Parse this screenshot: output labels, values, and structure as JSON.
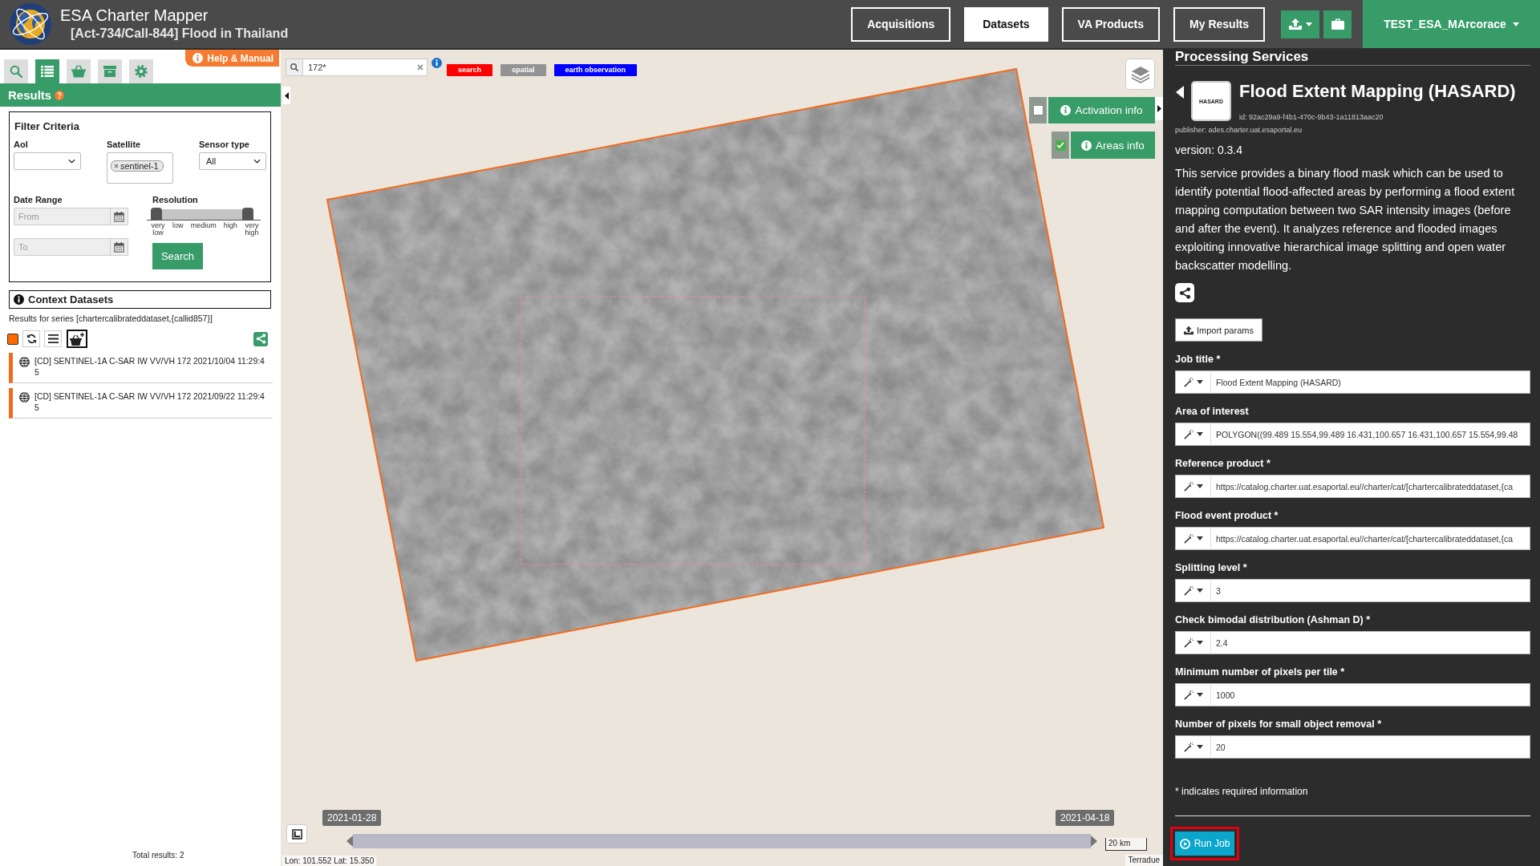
{
  "header": {
    "app_title": "ESA Charter Mapper",
    "subtitle": "[Act-734/Call-844] Flood in Thailand",
    "nav": [
      {
        "label": "Acquisitions",
        "selected": false
      },
      {
        "label": "Datasets",
        "selected": true
      },
      {
        "label": "VA Products",
        "selected": false
      },
      {
        "label": "My Results",
        "selected": false
      }
    ],
    "user": "TEST_ESA_MArcorace"
  },
  "left_panel": {
    "tabs": [
      {
        "kind": "search",
        "selected": false
      },
      {
        "kind": "list",
        "selected": true
      },
      {
        "kind": "basket",
        "selected": false
      },
      {
        "kind": "archive",
        "selected": false
      },
      {
        "kind": "settings",
        "selected": false
      }
    ],
    "help_link": "Help & Manual",
    "results_title": "Results",
    "filter": {
      "title": "Filter Criteria",
      "aoi_label": "AoI",
      "satellite_label": "Satellite",
      "satellite_tags": [
        "sentinel-1"
      ],
      "sensor_label": "Sensor type",
      "sensor_value": "All",
      "date_label": "Date Range",
      "from_placeholder": "From",
      "to_placeholder": "To",
      "resolution_label": "Resolution",
      "resolution_slider": {
        "handles": [
          {
            "level": 0
          },
          {
            "level": 1
          }
        ]
      },
      "resolution_ticks": [
        "very low",
        "low",
        "medium",
        "high",
        "very high"
      ],
      "search_button": "Search"
    },
    "context": {
      "title": "Context Datasets",
      "series": "Results for series [chartercalibrateddataset,{callid857}]",
      "items": [
        {
          "title": "[CD] SENTINEL-1A C-SAR IW VV/VH 172 2021/10/04 11:29:45"
        },
        {
          "title": "[CD] SENTINEL-1A C-SAR IW VV/VH 172 2021/09/22 11:29:45"
        }
      ]
    },
    "total_results": "Total results: 2"
  },
  "map": {
    "search": {
      "value": "172*"
    },
    "filter_tags": [
      {
        "label": "search",
        "color": "#ff0000"
      },
      {
        "label": "spatial",
        "color": "#939393"
      },
      {
        "label": "earth observation",
        "color": "#0000ff"
      }
    ],
    "overlay_buttons": [
      {
        "label": "Activation info",
        "checked": false
      },
      {
        "label": "Areas info",
        "checked": true
      }
    ],
    "timeline": {
      "start": "2021-01-28",
      "end": "2021-04-18",
      "handles": [
        {
          "level": 0
        },
        {
          "level": 1
        }
      ]
    },
    "coordinates": "Lon: 101.552 Lat: 15.350",
    "scale": "20 km",
    "attribution": "Terradue"
  },
  "service": {
    "section_title": "Processing Services",
    "logo_text": "HASARD",
    "title": "Flood Extent Mapping (HASARD)",
    "id": "id: 92ac29a9-f4b1-470c-9b43-1a11813aac20",
    "publisher": "publisher: ades.charter.uat.esaportal.eu",
    "version": "version: 0.3.4",
    "description": "This service provides a binary flood mask which can be used to identify potential flood-affected areas by performing a flood extent mapping computation between two SAR intensity images (before and after the event). It analyzes reference and flooded images exploiting innovative hierarchical image splitting and open water backscatter modelling.",
    "import_button": "Import params",
    "fields": [
      {
        "label": "Job title *",
        "value": "Flood Extent Mapping (HASARD)"
      },
      {
        "label": "Area of interest",
        "value": "POLYGON((99.489 15.554,99.489 16.431,100.657 16.431,100.657 15.554,99.48"
      },
      {
        "label": "Reference product *",
        "value": "https://catalog.charter.uat.esaportal.eu//charter/cat/[chartercalibrateddataset,{ca"
      },
      {
        "label": "Flood event product *",
        "value": "https://catalog.charter.uat.esaportal.eu//charter/cat/[chartercalibrateddataset,{ca"
      },
      {
        "label": "Splitting level *",
        "value": "3"
      },
      {
        "label": "Check bimodal distribution (Ashman D) *",
        "value": "2.4"
      },
      {
        "label": "Minimum number of pixels per tile *",
        "value": "1000"
      },
      {
        "label": "Number of pixels for small object removal *",
        "value": "20"
      }
    ],
    "required_note": "* indicates required information",
    "run_button": "Run Job"
  }
}
